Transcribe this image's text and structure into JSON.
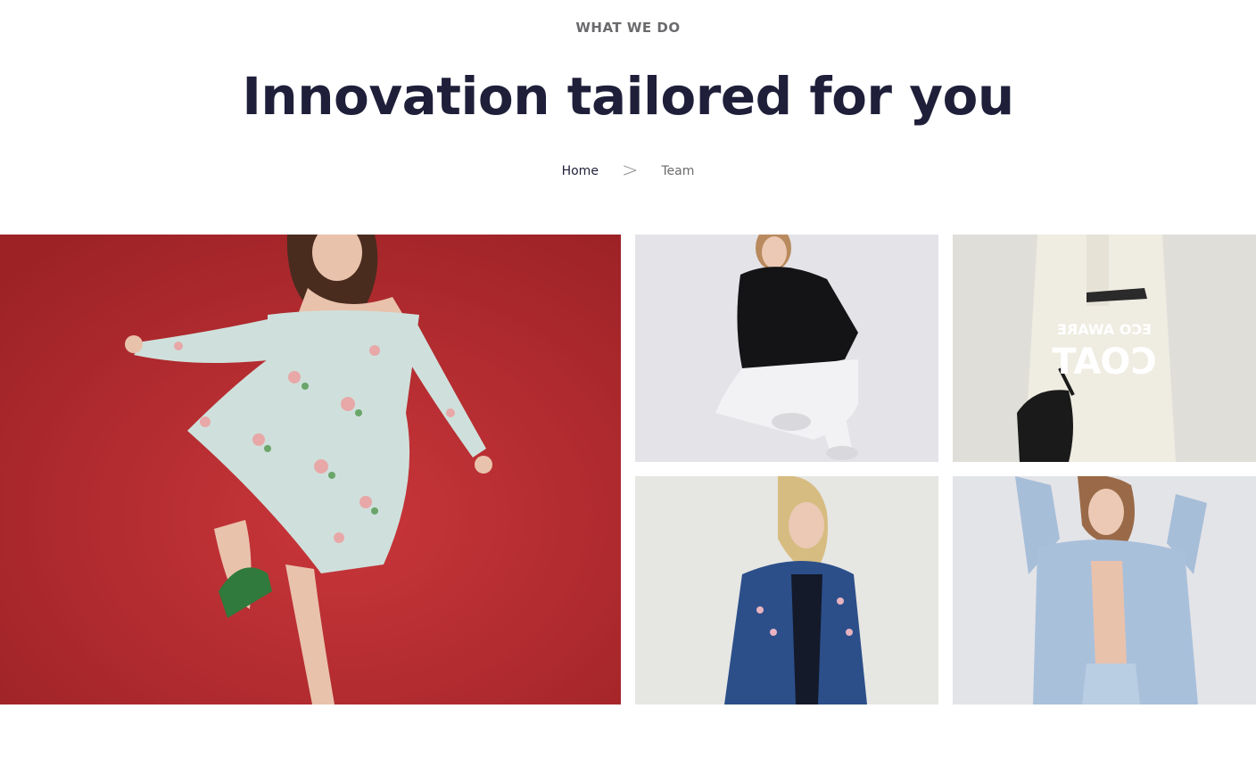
{
  "section": {
    "eyebrow": "WHAT WE DO",
    "title": "Innovation tailored for you"
  },
  "breadcrumb": {
    "home": "Home",
    "separator": ">",
    "current": "Team"
  },
  "gallery": {
    "images": [
      {
        "name": "model-floral-dress-red-background"
      },
      {
        "name": "model-black-hoodie-white-pants"
      },
      {
        "name": "eco-aware-coat-with-bag",
        "overlay_line1": "ECO AWARE",
        "overlay_line2": "COAT"
      },
      {
        "name": "model-dark-denim-jacket"
      },
      {
        "name": "model-light-denim-jacket"
      }
    ]
  },
  "colors": {
    "title": "#1f1f3a",
    "eyebrow": "#6b6b6e",
    "hero_background": "#b5292c"
  }
}
